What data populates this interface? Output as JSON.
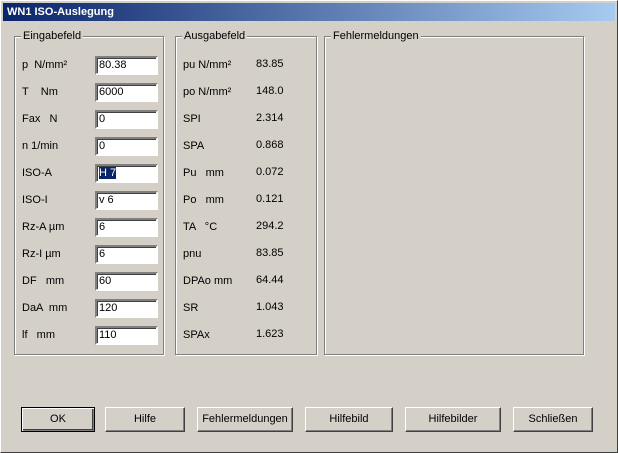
{
  "window": {
    "title": "WN1   ISO-Auslegung"
  },
  "groups": {
    "input": "Eingabefeld",
    "output": "Ausgabefeld",
    "errors": "Fehlermeldungen"
  },
  "inputs": [
    {
      "label": "p  N/mm²",
      "value": "80.38"
    },
    {
      "label": "T    Nm",
      "value": "6000"
    },
    {
      "label": "Fax   N",
      "value": "0"
    },
    {
      "label": "n 1/min",
      "value": "0"
    },
    {
      "label": "ISO-A",
      "value": "H 7",
      "selected": true
    },
    {
      "label": "ISO-I",
      "value": "v 6"
    },
    {
      "label": "Rz-A µm",
      "value": "6"
    },
    {
      "label": "Rz-I µm",
      "value": "6"
    },
    {
      "label": "DF   mm",
      "value": "60"
    },
    {
      "label": "DaA  mm",
      "value": "120"
    },
    {
      "label": "lf   mm",
      "value": "110"
    }
  ],
  "outputs": [
    {
      "label": "pu N/mm²",
      "value": "83.85"
    },
    {
      "label": "po N/mm²",
      "value": "148.0"
    },
    {
      "label": "SPI",
      "value": "2.314"
    },
    {
      "label": "SPA",
      "value": "0.868"
    },
    {
      "label": "Pu   mm",
      "value": "0.072"
    },
    {
      "label": "Po   mm",
      "value": "0.121"
    },
    {
      "label": "TA   °C",
      "value": "294.2"
    },
    {
      "label": "pnu",
      "value": "83.85"
    },
    {
      "label": "DPAo mm",
      "value": "64.44"
    },
    {
      "label": "SR",
      "value": "1.043"
    },
    {
      "label": "SPAx",
      "value": "1.623"
    }
  ],
  "buttons": {
    "ok": "OK",
    "help": "Hilfe",
    "errors": "Fehlermeldungen",
    "help_image": "Hilfebild",
    "help_images": "Hilfebilder",
    "close": "Schließen"
  }
}
